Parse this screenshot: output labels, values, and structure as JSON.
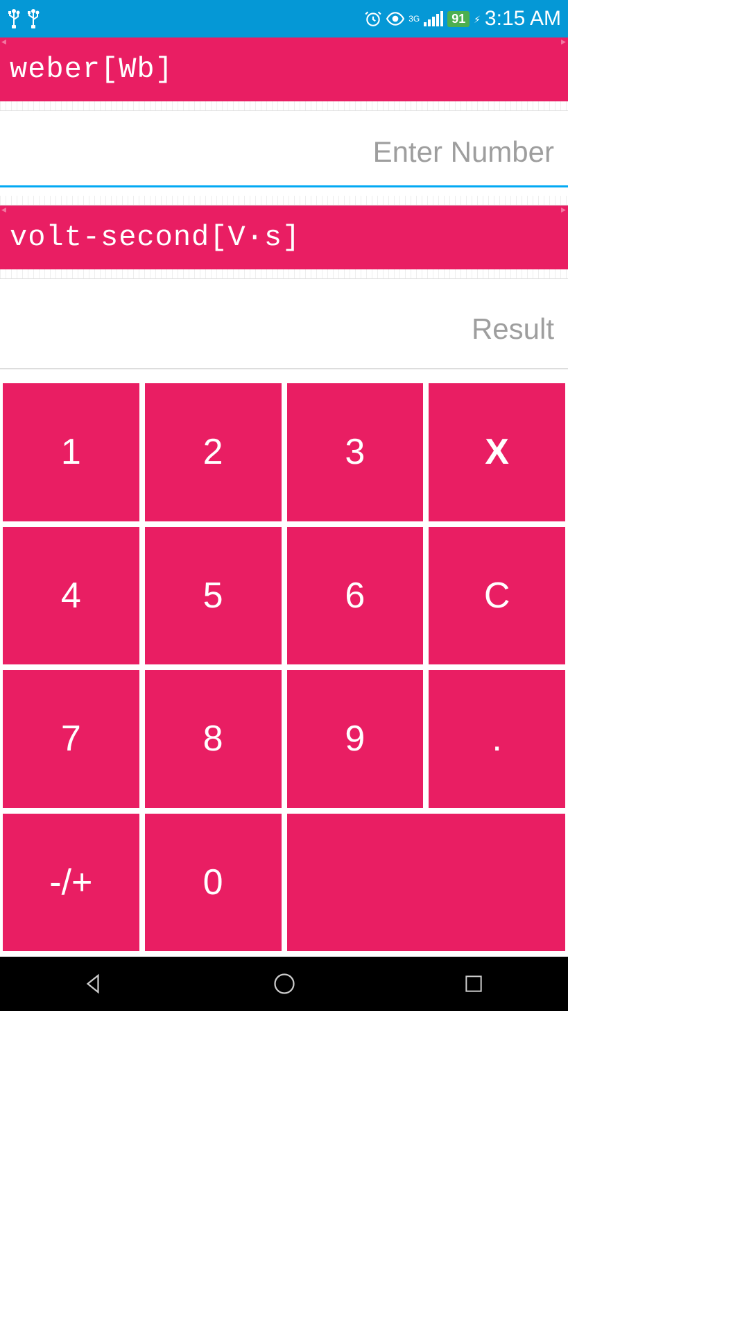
{
  "statusBar": {
    "time": "3:15 AM",
    "battery": "91",
    "network": "3G"
  },
  "unitFrom": {
    "label": "weber[Wb]"
  },
  "unitTo": {
    "label": "volt-second[V·s]"
  },
  "inputField": {
    "placeholder": "Enter Number",
    "value": ""
  },
  "resultField": {
    "placeholder": "Result",
    "value": ""
  },
  "keypad": {
    "keys": [
      "1",
      "2",
      "3",
      "X",
      "4",
      "5",
      "6",
      "C",
      "7",
      "8",
      "9",
      ".",
      "-/+",
      "0"
    ]
  },
  "colors": {
    "primary": "#e91e63",
    "statusBar": "#0598d6",
    "inputUnderline": "#03a9f4"
  }
}
